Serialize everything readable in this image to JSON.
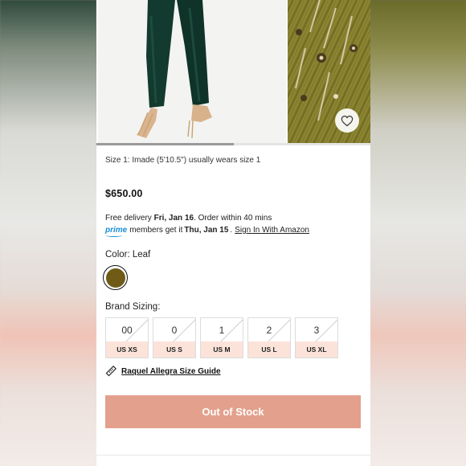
{
  "product": {
    "size_note": "Size 1: Imade (5'10.5\") usually wears size 1",
    "price": "$650.00",
    "favorite_icon": "heart-outline-icon"
  },
  "delivery": {
    "prefix": "Free delivery",
    "date": "Fri, Jan 16",
    "suffix": ". Order within 40 mins",
    "prime_logo": "prime",
    "prime_text": "members get it",
    "prime_date": "Thu, Jan 15",
    "sign_in_link": "Sign In With Amazon"
  },
  "color": {
    "label": "Color: Leaf",
    "swatch_hex": "#6f5b16"
  },
  "sizing": {
    "label": "Brand Sizing:",
    "options": [
      {
        "size": "00",
        "us": "US XS"
      },
      {
        "size": "0",
        "us": "US S"
      },
      {
        "size": "1",
        "us": "US M"
      },
      {
        "size": "2",
        "us": "US L"
      },
      {
        "size": "3",
        "us": "US XL"
      }
    ],
    "guide_icon": "ruler-icon",
    "guide_label": "Raquel Allegra Size Guide"
  },
  "action": {
    "button_label": "Out of Stock",
    "button_color": "#e3a08c"
  },
  "gallery": {
    "scroll_progress": 0.5
  }
}
